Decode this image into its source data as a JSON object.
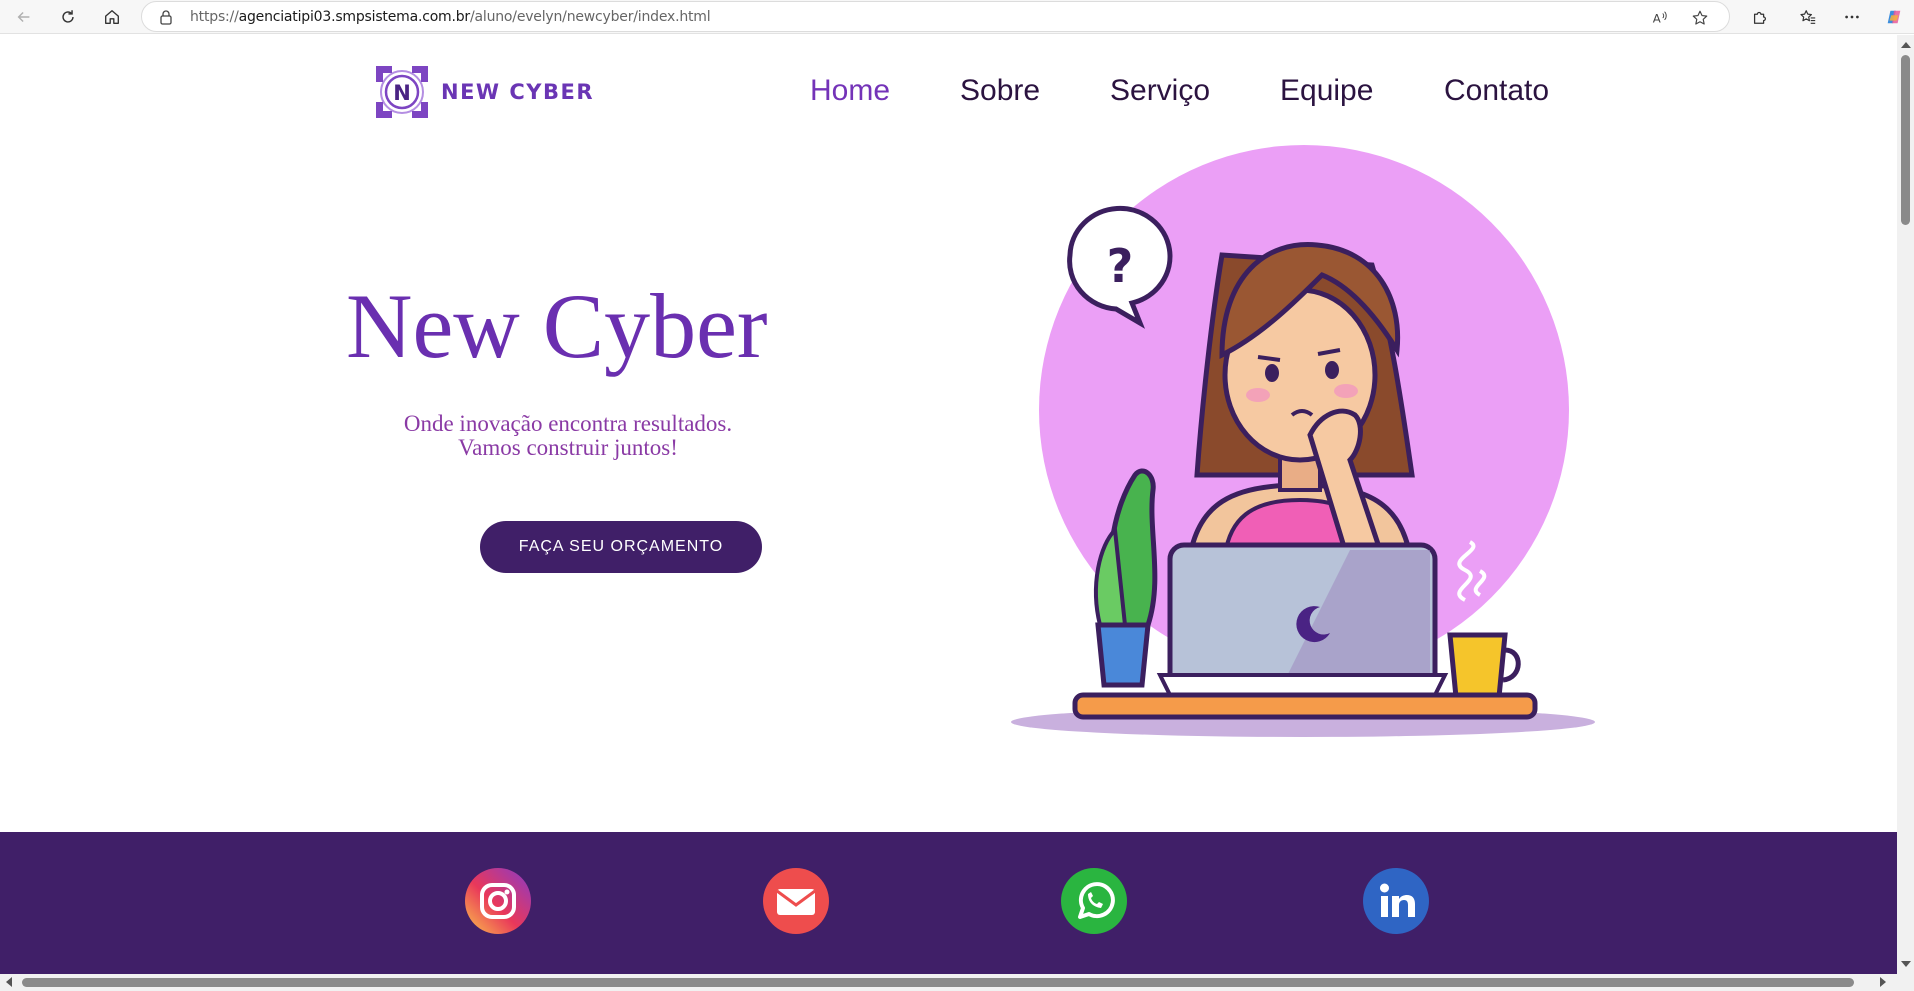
{
  "browser": {
    "url_prefix": "https://",
    "url_host": "agenciatipi03.smpsistema.com.br",
    "url_path": "/aluno/evelyn/newcyber/index.html",
    "icons": [
      "back-icon",
      "reload-icon",
      "home-icon",
      "lock-icon",
      "read-aloud-icon",
      "favorite-star-icon",
      "extensions-icon",
      "favorites-icon",
      "more-icon",
      "copilot-icon"
    ]
  },
  "header": {
    "logo_letter": "N",
    "logo_text": "NEW CYBER",
    "nav": [
      {
        "label": "Home",
        "active": true
      },
      {
        "label": "Sobre",
        "active": false
      },
      {
        "label": "Serviço",
        "active": false
      },
      {
        "label": "Equipe",
        "active": false
      },
      {
        "label": "Contato",
        "active": false
      }
    ]
  },
  "hero": {
    "title": "New Cyber",
    "subtitle_line1": "Onde inovação encontra resultados.",
    "subtitle_line2": "Vamos construir juntos!",
    "cta_label": "FAÇA SEU ORÇAMENTO",
    "illustration": "woman-thinking-at-laptop-illustration"
  },
  "footer": {
    "social": [
      {
        "name": "instagram-icon"
      },
      {
        "name": "email-icon"
      },
      {
        "name": "whatsapp-icon"
      },
      {
        "name": "linkedin-icon"
      }
    ]
  },
  "colors": {
    "brand_purple": "#401f68",
    "accent_purple": "#6a2fb0",
    "nav_active": "#7433b8",
    "circle_pink": "#eb9ff6"
  }
}
